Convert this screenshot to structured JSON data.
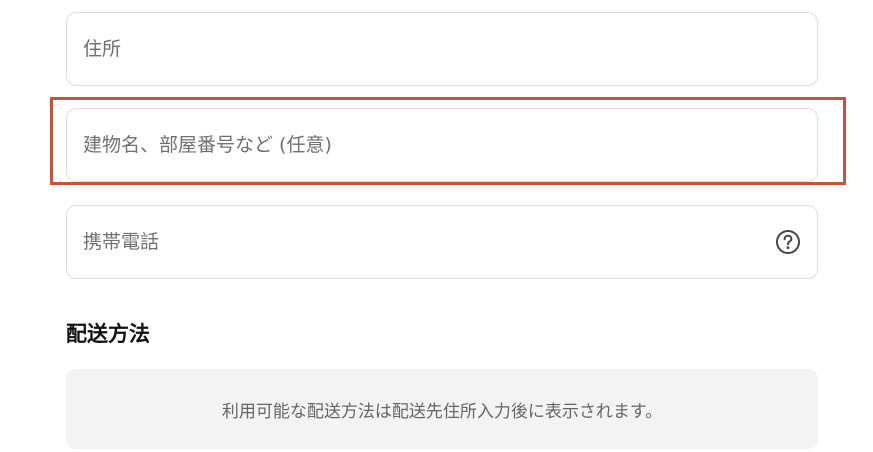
{
  "form": {
    "address": {
      "placeholder": "住所",
      "value": ""
    },
    "building": {
      "placeholder": "建物名、部屋番号など (任意)",
      "value": ""
    },
    "phone": {
      "placeholder": "携帯電話",
      "value": "",
      "help_icon": "question-circle-icon"
    }
  },
  "shipping": {
    "title": "配送方法",
    "notice": "利用可能な配送方法は配送先住所入力後に表示されます。"
  },
  "colors": {
    "highlight_border": "#c4543c",
    "field_border": "#dedede",
    "notice_background": "#f3f3f3"
  }
}
